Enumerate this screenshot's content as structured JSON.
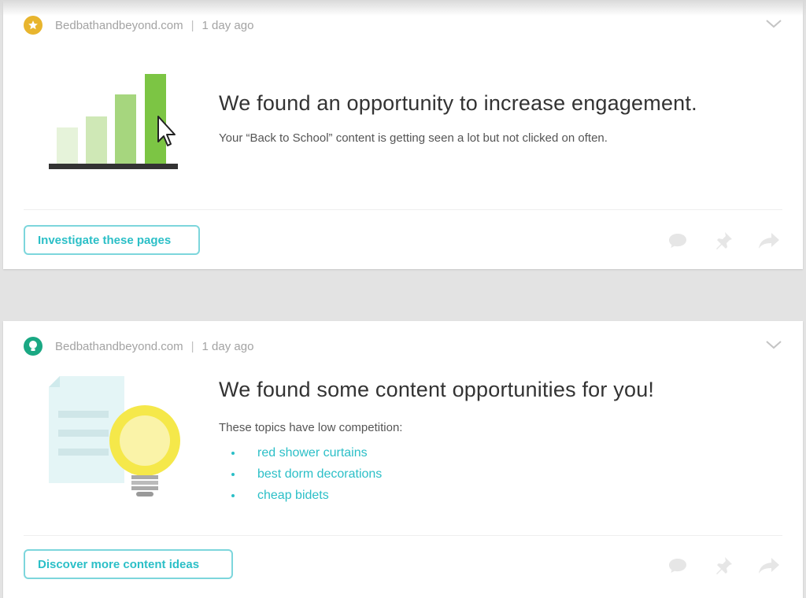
{
  "cards": [
    {
      "source": "Bedbathandbeyond.com",
      "time": "1 day ago",
      "badge_icon": "star-icon",
      "title": "We found an opportunity to increase engagement.",
      "description": "Your “Back to School” content is getting seen a lot but not clicked on often.",
      "action_label": "Investigate these pages"
    },
    {
      "source": "Bedbathandbeyond.com",
      "time": "1 day ago",
      "badge_icon": "lightbulb-icon",
      "title": "We found some content opportunities for you!",
      "description": "These topics have low competition:",
      "topics": [
        "red shower curtains",
        "best dorm decorations",
        "cheap bidets"
      ],
      "action_label": "Discover more content ideas"
    }
  ],
  "colors": {
    "accent": "#2bbfc7",
    "star_badge": "#e8b52e",
    "bulb_badge": "#1aa883",
    "bar_green": "#7cc544",
    "bulb_yellow": "#f5e84a"
  },
  "icons": [
    "star-icon",
    "lightbulb-icon",
    "chevron-down-icon",
    "comment-icon",
    "pin-icon",
    "share-icon"
  ]
}
